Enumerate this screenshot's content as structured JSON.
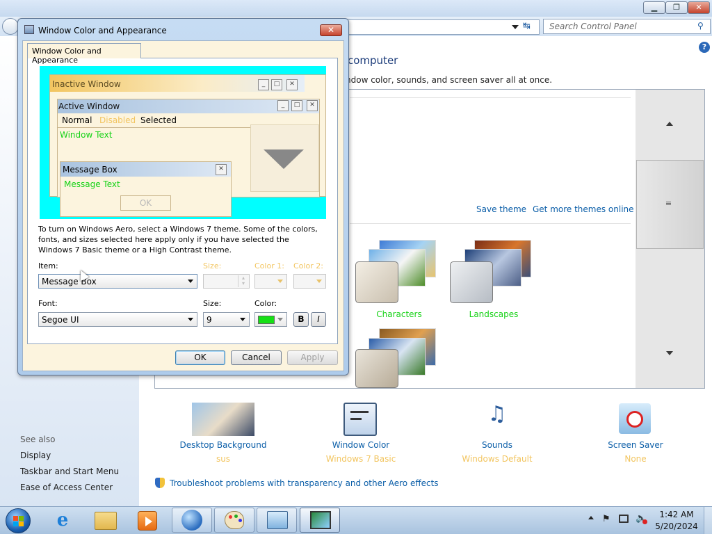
{
  "control_panel": {
    "search_placeholder": "Search Control Panel",
    "heading": "computer",
    "subheading": "ndow color, sounds, and screen saver all at once.",
    "save_theme": "Save theme",
    "get_more_themes": "Get more themes online",
    "themes": [
      {
        "name": "Characters"
      },
      {
        "name": "Landscapes"
      }
    ],
    "bottom_items": [
      {
        "label": "Desktop Background",
        "value": "sus",
        "icon": "desktop-background-icon"
      },
      {
        "label": "Window Color",
        "value": "Windows 7 Basic",
        "icon": "window-color-icon"
      },
      {
        "label": "Sounds",
        "value": "Windows Default",
        "icon": "sounds-icon"
      },
      {
        "label": "Screen Saver",
        "value": "None",
        "icon": "screen-saver-icon"
      }
    ],
    "troubleshoot": "Troubleshoot problems with transparency and other Aero effects",
    "see_also": {
      "title": "See also",
      "links": [
        "Display",
        "Taskbar and Start Menu",
        "Ease of Access Center"
      ]
    }
  },
  "dialog": {
    "title": "Window Color and Appearance",
    "tab": "Window Color and Appearance",
    "preview": {
      "inactive_window": "Inactive Window",
      "active_window": "Active Window",
      "menu_normal": "Normal",
      "menu_disabled": "Disabled",
      "menu_selected": "Selected",
      "window_text": "Window Text",
      "message_box": "Message Box",
      "message_text": "Message Text",
      "ok": "OK"
    },
    "info_text": "To turn on Windows Aero, select a Windows 7 theme.  Some of the colors, fonts, and sizes selected here apply only if you have selected the Windows 7 Basic theme or a High Contrast theme.",
    "item_label": "Item:",
    "item_value": "Message Box",
    "size1_label": "Size:",
    "color1_label": "Color 1:",
    "color2_label": "Color 2:",
    "font_label": "Font:",
    "font_value": "Segoe UI",
    "size2_label": "Size:",
    "size2_value": "9",
    "color_label": "Color:",
    "bold": "B",
    "italic": "I",
    "ok": "OK",
    "cancel": "Cancel",
    "apply": "Apply"
  },
  "taskbar": {
    "time": "1:42 AM",
    "date": "5/20/2024"
  },
  "colors": {
    "link": "#0b5ea8",
    "disabled_text": "#f2c560",
    "preview_background": "#00ffff",
    "preview_text": "#16d216"
  }
}
